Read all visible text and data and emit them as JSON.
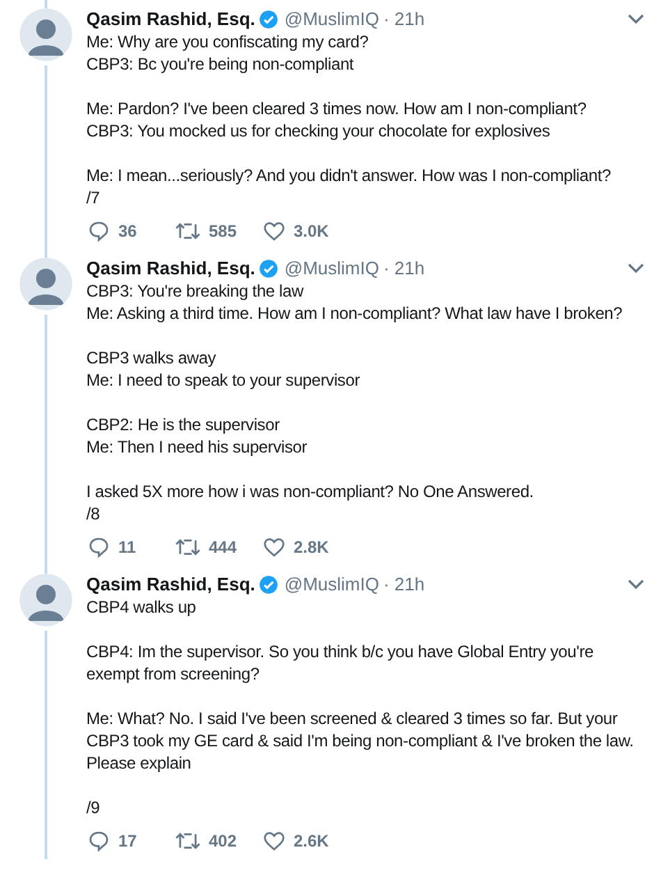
{
  "tweets": [
    {
      "name": "Qasim Rashid, Esq.",
      "handle": "@MuslimIQ",
      "time": "· 21h",
      "verified": true,
      "paragraphs": [
        [
          "Me: Why are you confiscating my card?",
          "CBP3: Bc you're being non-compliant"
        ],
        [
          "Me: Pardon? I've been cleared 3 times now. How am I non-compliant?",
          "CBP3: You mocked us for checking your chocolate for explosives"
        ],
        [
          "Me: I mean...seriously? And you didn't answer. How was I non-compliant?",
          "/7"
        ]
      ],
      "replies": "36",
      "retweets": "585",
      "likes": "3.0K"
    },
    {
      "name": "Qasim Rashid, Esq.",
      "handle": "@MuslimIQ",
      "time": "· 21h",
      "verified": true,
      "paragraphs": [
        [
          "CBP3: You're breaking the law",
          "Me: Asking a third time. How am I non-compliant? What law have I broken?"
        ],
        [
          "CBP3 walks away",
          "Me: I need to speak to your supervisor"
        ],
        [
          "CBP2: He is the supervisor",
          "Me: Then I need his supervisor"
        ],
        [
          "I asked 5X more how i was non-compliant? No One Answered.",
          "/8"
        ]
      ],
      "replies": "11",
      "retweets": "444",
      "likes": "2.8K"
    },
    {
      "name": "Qasim Rashid, Esq.",
      "handle": "@MuslimIQ",
      "time": "· 21h",
      "verified": true,
      "paragraphs": [
        [
          "CBP4 walks up"
        ],
        [
          "CBP4: Im the supervisor. So you think b/c you have Global Entry you're exempt from screening?"
        ],
        [
          "Me: What? No. I said I've been screened & cleared 3 times so far. But your CBP3 took my GE card & said I'm being non-compliant & I've broken the law. Please explain"
        ],
        [
          "/9"
        ]
      ],
      "replies": "17",
      "retweets": "402",
      "likes": "2.6K"
    }
  ]
}
